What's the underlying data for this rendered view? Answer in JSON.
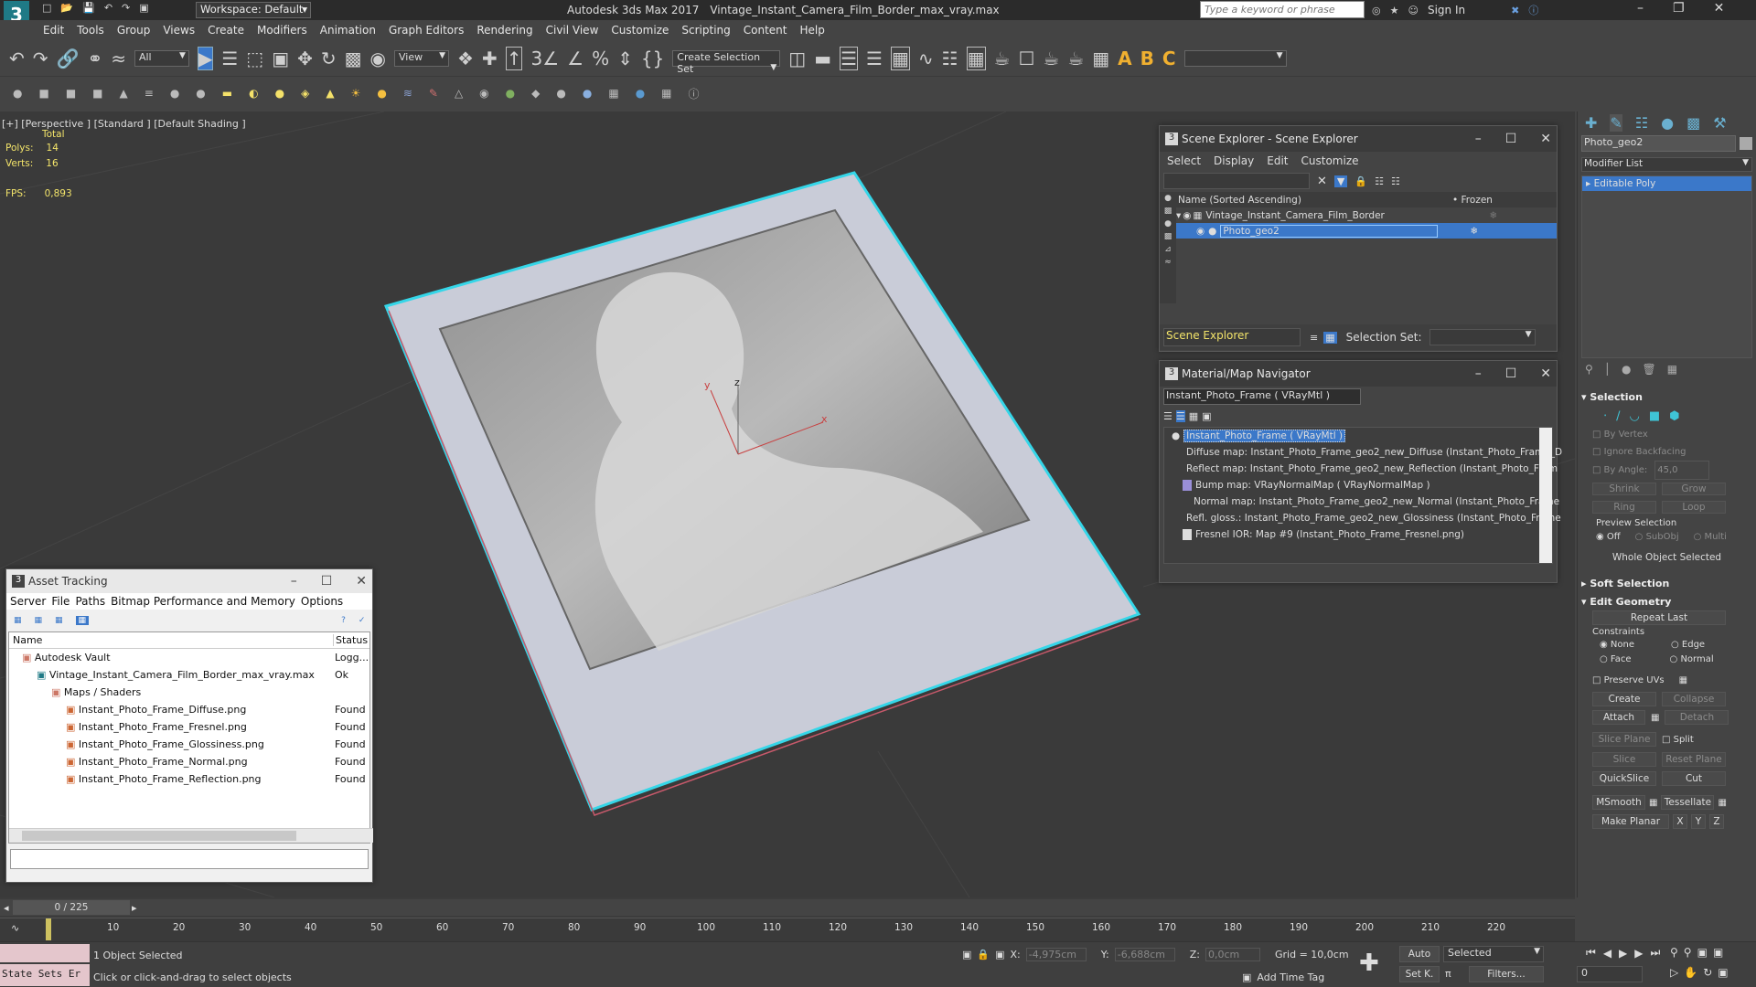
{
  "app": {
    "title": "Autodesk 3ds Max 2017",
    "file": "Vintage_Instant_Camera_Film_Border_max_vray.max",
    "workspace": "Workspace: Default",
    "search_placeholder": "Type a keyword or phrase",
    "sign_in": "Sign In"
  },
  "menu": [
    "Edit",
    "Tools",
    "Group",
    "Views",
    "Create",
    "Modifiers",
    "Animation",
    "Graph Editors",
    "Rendering",
    "Civil View",
    "Customize",
    "Scripting",
    "Content",
    "Help"
  ],
  "toolbar": {
    "filter": "All",
    "view_dropdown": "View",
    "selection_set": "Create Selection Set"
  },
  "viewport": {
    "label": "[+] [Perspective ] [Standard ] [Default Shading ]",
    "stats_total": "Total",
    "polys_label": "Polys:",
    "polys": "14",
    "verts_label": "Verts:",
    "verts": "16",
    "fps_label": "FPS:",
    "fps": "0,893",
    "axis_x": "x",
    "axis_y": "y",
    "axis_z": "z"
  },
  "scene_explorer": {
    "title": "Scene Explorer - Scene Explorer",
    "menu": [
      "Select",
      "Display",
      "Edit",
      "Customize"
    ],
    "col_name": "Name (Sorted Ascending)",
    "col_frozen": "• Frozen",
    "rows": [
      {
        "name": "Vintage_Instant_Camera_Film_Border"
      },
      {
        "name": "Photo_geo2"
      }
    ],
    "footer_label": "Scene Explorer",
    "selection_set_label": "Selection Set:"
  },
  "material_navigator": {
    "title": "Material/Map Navigator",
    "current": "Instant_Photo_Frame  ( VRayMtl )",
    "items": [
      "Instant_Photo_Frame  ( VRayMtl )",
      "Diffuse map: Instant_Photo_Frame_geo2_new_Diffuse (Instant_Photo_Frame_D",
      "Reflect map: Instant_Photo_Frame_geo2_new_Reflection (Instant_Photo_Fram",
      "Bump map: VRayNormalMap  ( VRayNormalMap )",
      "Normal map: Instant_Photo_Frame_geo2_new_Normal (Instant_Photo_Frame",
      "Refl. gloss.: Instant_Photo_Frame_geo2_new_Glossiness (Instant_Photo_Frame",
      "Fresnel IOR: Map #9 (Instant_Photo_Frame_Fresnel.png)"
    ]
  },
  "asset_tracking": {
    "title": "Asset Tracking",
    "menu": [
      "Server",
      "File",
      "Paths",
      "Bitmap Performance and Memory",
      "Options"
    ],
    "col_name": "Name",
    "col_status": "Status",
    "rows": [
      {
        "name": "Autodesk Vault",
        "status": "Logg..."
      },
      {
        "name": "Vintage_Instant_Camera_Film_Border_max_vray.max",
        "status": "Ok"
      },
      {
        "name": "Maps / Shaders",
        "status": ""
      },
      {
        "name": "Instant_Photo_Frame_Diffuse.png",
        "status": "Found"
      },
      {
        "name": "Instant_Photo_Frame_Fresnel.png",
        "status": "Found"
      },
      {
        "name": "Instant_Photo_Frame_Glossiness.png",
        "status": "Found"
      },
      {
        "name": "Instant_Photo_Frame_Normal.png",
        "status": "Found"
      },
      {
        "name": "Instant_Photo_Frame_Reflection.png",
        "status": "Found"
      }
    ]
  },
  "command_panel": {
    "object_name": "Photo_geo2",
    "modifier_list": "Modifier List",
    "modifier": "Editable Poly",
    "selection": {
      "title": "Selection",
      "by_vertex": "By Vertex",
      "ignore_backfacing": "Ignore Backfacing",
      "by_angle": "By Angle:",
      "angle": "45,0",
      "shrink": "Shrink",
      "grow": "Grow",
      "ring": "Ring",
      "loop": "Loop",
      "preview": "Preview Selection",
      "off": "Off",
      "subobj": "SubObj",
      "multi": "Multi",
      "status": "Whole Object Selected"
    },
    "soft_selection": "Soft Selection",
    "edit_geometry": {
      "title": "Edit Geometry",
      "repeat_last": "Repeat Last",
      "constraints": "Constraints",
      "none": "None",
      "edge": "Edge",
      "face": "Face",
      "normal": "Normal",
      "preserve_uvs": "Preserve UVs",
      "create": "Create",
      "collapse": "Collapse",
      "attach": "Attach",
      "detach": "Detach",
      "slice_plane": "Slice Plane",
      "split": "Split",
      "slice": "Slice",
      "reset_plane": "Reset Plane",
      "quickslice": "QuickSlice",
      "cut": "Cut",
      "msmooth": "MSmooth",
      "tessellate": "Tessellate",
      "make_planar": "Make Planar",
      "x": "X",
      "y": "Y",
      "z": "Z"
    }
  },
  "timeline": {
    "frame": "0 / 225",
    "ticks": [
      "10",
      "20",
      "30",
      "40",
      "50",
      "60",
      "70",
      "80",
      "90",
      "100",
      "110",
      "120",
      "130",
      "140",
      "150",
      "160",
      "170",
      "180",
      "190",
      "200",
      "210",
      "220"
    ]
  },
  "status": {
    "state_sets": "State Sets Er",
    "selected": "1 Object Selected",
    "prompt": "Click or click-and-drag to select objects",
    "x_label": "X:",
    "x": "-4,975cm",
    "y_label": "Y:",
    "y": "-6,688cm",
    "z_label": "Z:",
    "z": "0,0cm",
    "grid": "Grid = 10,0cm",
    "add_time_tag": "Add Time Tag",
    "auto": "Auto",
    "set_k": "Set K.",
    "selected_dd": "Selected",
    "filters": "Filters...",
    "frame_field": "0"
  },
  "colors": {
    "accent_blue": "#3b78c9",
    "selection_cyan": "#35d6e8",
    "frame_border": "#c9ccd8"
  }
}
